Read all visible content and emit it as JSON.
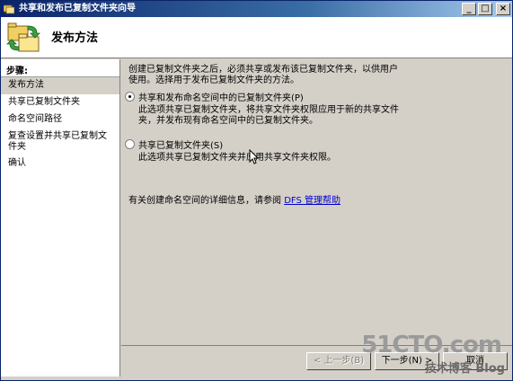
{
  "window": {
    "title": "共享和发布已复制文件夹向导",
    "controls": {
      "minimize": "_",
      "maximize": "□",
      "close": "×"
    }
  },
  "header": {
    "title": "发布方法"
  },
  "sidebar": {
    "heading": "步骤:",
    "items": [
      {
        "label": "发布方法",
        "active": true
      },
      {
        "label": "共享已复制文件夹",
        "active": false
      },
      {
        "label": "命名空间路径",
        "active": false
      },
      {
        "label": "复查设置并共享已复制文件夹",
        "active": false
      },
      {
        "label": "确认",
        "active": false
      }
    ]
  },
  "main": {
    "intro": "创建已复制文件夹之后，必须共享或发布该已复制文件夹，以供用户使用。选择用于发布已复制文件夹的方法。",
    "options": [
      {
        "label": "共享和发布命名空间中的已复制文件夹(P)",
        "selected": true,
        "description": "此选项共享已复制文件夹，将共享文件夹权限应用于新的共享文件夹，并发布现有命名空间中的已复制文件夹。"
      },
      {
        "label": "共享已复制文件夹(S)",
        "selected": false,
        "description": "此选项共享已复制文件夹并应用共享文件夹权限。"
      }
    ],
    "help_prefix": "有关创建命名空间的详细信息，请参阅",
    "help_link": "DFS 管理帮助"
  },
  "footer": {
    "prev": "< 上一步(B)",
    "next": "下一步(N) >",
    "cancel": "取消"
  },
  "watermark": {
    "brand": "51CTO.com",
    "tagline": "技术博客 Blog"
  }
}
